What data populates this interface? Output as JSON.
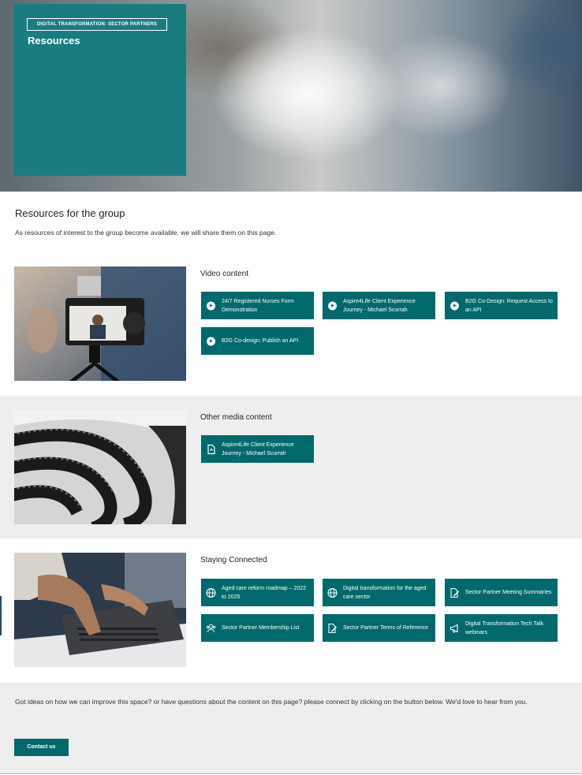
{
  "hero": {
    "tag": "DIGITAL TRANSFORMATION: SECTOR PARTNERS",
    "title": "Resources"
  },
  "intro": {
    "title": "Resources for the group",
    "text": "As resources of interest to the group become available, we will share them on this page."
  },
  "sections": [
    {
      "heading": "Video content",
      "buttons": [
        {
          "label": "24/7 Registered Nurses Form Demonstration",
          "icon": "play-icon"
        },
        {
          "label": "Aspire4Life Client Experience Journey - Michael Scurrah",
          "icon": "play-icon"
        },
        {
          "label": "B2G Co-Design: Request Access to an API",
          "icon": "play-icon"
        },
        {
          "label": "B2G Co-design: Publish an API",
          "icon": "play-icon"
        }
      ]
    },
    {
      "heading": "Other media content",
      "buttons": [
        {
          "label": "Aspire4Life Client Experience Journey - Michael Scurrah",
          "icon": "document-icon"
        }
      ]
    },
    {
      "heading": "Staying Connected",
      "buttons": [
        {
          "label": "Aged care reform roadmap – 2022 to 2025",
          "icon": "globe-icon"
        },
        {
          "label": "Digital transformation for the aged care sector",
          "icon": "globe-icon"
        },
        {
          "label": "Sector Partner Meeting Summaries",
          "icon": "document-edit-icon"
        },
        {
          "label": "Sector Partner Membership List",
          "icon": "people-icon"
        },
        {
          "label": "Sector Partner Terms of Reference",
          "icon": "document-edit-icon"
        },
        {
          "label": "Digital Transformation Tech Talk webinars",
          "icon": "megaphone-icon"
        }
      ]
    }
  ],
  "feedback": {
    "text": "Got ideas on how we can improve this space? or have questions about the content on this page? please connect by clicking on the button below. We'd love to hear from you.",
    "button": "Contact us"
  },
  "colors": {
    "accent": "#00696c",
    "hero_card": "#1b7c80",
    "section_gray": "#eeeeee"
  }
}
